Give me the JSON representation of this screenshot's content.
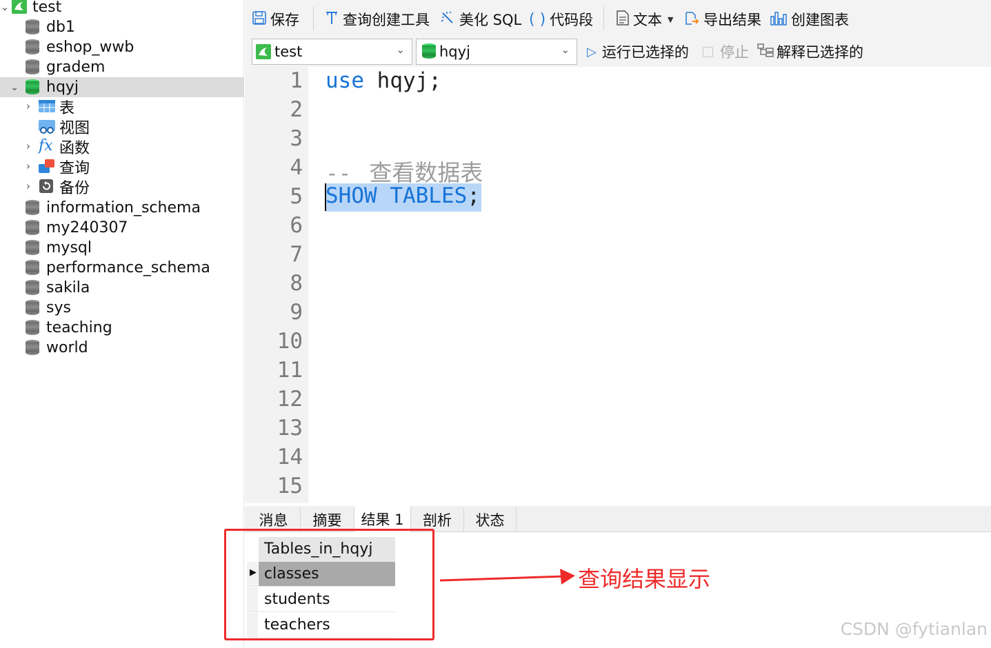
{
  "navigator": {
    "connection": "test",
    "databases": [
      "db1",
      "eshop_wwb",
      "gradem",
      "hqyj",
      "information_schema",
      "my240307",
      "mysql",
      "performance_schema",
      "sakila",
      "sys",
      "teaching",
      "world"
    ],
    "selected_database": "hqyj",
    "children": [
      "表",
      "视图",
      "函数",
      "查询",
      "备份"
    ]
  },
  "toolbar": {
    "save": "保存",
    "query_builder": "查询创建工具",
    "beautify": "美化 SQL",
    "snippet": "代码段",
    "text": "文本",
    "export": "导出结果",
    "chart": "创建图表"
  },
  "selectors": {
    "connection": "test",
    "database": "hqyj"
  },
  "run_bar": {
    "run_selected": "运行已选择的",
    "stop": "停止",
    "explain_selected": "解释已选择的"
  },
  "editor": {
    "line_numbers": [
      "1",
      "2",
      "3",
      "4",
      "5",
      "6",
      "7",
      "8",
      "9",
      "10",
      "11",
      "12",
      "13",
      "14",
      "15"
    ],
    "line1_kw": "use",
    "line1_rest": " hqyj;",
    "line4_comment_dash": "--",
    "line4_comment_text": "查看数据表",
    "line5_kw": "SHOW TABLES",
    "line5_rest": ";"
  },
  "result_tabs": [
    "消息",
    "摘要",
    "结果 1",
    "剖析",
    "状态"
  ],
  "active_result_tab": "结果 1",
  "result_grid": {
    "column": "Tables_in_hqyj",
    "rows": [
      "classes",
      "students",
      "teachers"
    ]
  },
  "annotation": {
    "text": "查询结果显示",
    "color": "#ee2a2a"
  },
  "watermark": "CSDN @fytianlan",
  "colors": {
    "keyword": "#1673d8",
    "selection": "#b8d6f7",
    "db_icon_active": "#2fb552",
    "db_icon_default": "#7a7a7a"
  }
}
